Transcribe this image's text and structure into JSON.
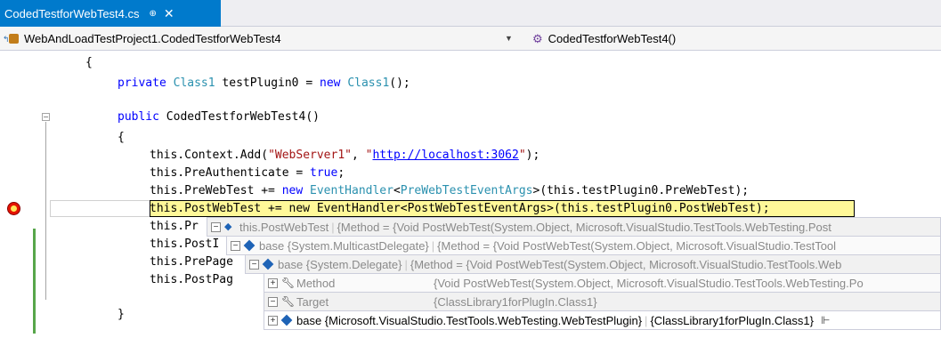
{
  "tab": {
    "title": "CodedTestforWebTest4.cs",
    "pin": "⊕",
    "close": "✕"
  },
  "navbar": {
    "class_combo": "WebAndLoadTestProject1.CodedTestforWebTest4",
    "member_combo": "CodedTestforWebTest4()"
  },
  "code": {
    "l0": "{",
    "l1_kw": "private",
    "l1_ty": "Class1",
    "l1_mid": " testPlugin0 = ",
    "l1_kw2": "new",
    "l1_ty2": "Class1",
    "l1_end": "();",
    "l2_kw": "public",
    "l2_rest": " CodedTestforWebTest4()",
    "l3": "{",
    "l4_pre": "this.Context.Add(",
    "l4_str": "\"WebServer1\"",
    "l4_mid": ", ",
    "l4_q1": "\"",
    "l4_url": "http://localhost:3062",
    "l4_q2": "\"",
    "l4_end": ");",
    "l5_pre": "this.PreAuthenticate = ",
    "l5_kw": "true",
    "l5_end": ";",
    "l6_pre": "this.PreWebTest += ",
    "l6_kw": "new",
    "l6_ty": "EventHandler",
    "l6_lt": "<",
    "l6_ty2": "PreWebTestEventArgs",
    "l6_end": ">(this.testPlugin0.PreWebTest);",
    "l7": "this.PostWebTest += new EventHandler<PostWebTestEventArgs>(this.testPlugin0.PostWebTest);",
    "l8": "this.Pr",
    "l9": "this.PostI",
    "l10": "this.PrePage",
    "l11": "this.PostPag",
    "l12": "}"
  },
  "datatips": [
    {
      "expander": "⊟",
      "name": "this.PostWebTest",
      "value": "{Method = {Void PostWebTest(System.Object, Microsoft.VisualStudio.TestTools.WebTesting.Post"
    },
    {
      "expander": "⊟",
      "name": "base {System.MulticastDelegate}",
      "value": "{Method = {Void PostWebTest(System.Object, Microsoft.VisualStudio.TestTool"
    },
    {
      "expander": "⊟",
      "name": "base {System.Delegate}",
      "value": "{Method = {Void PostWebTest(System.Object, Microsoft.VisualStudio.TestTools.Web"
    },
    {
      "expander": "⊞",
      "name": "Method",
      "value": "{Void PostWebTest(System.Object, Microsoft.VisualStudio.TestTools.WebTesting.Po"
    },
    {
      "expander": "⊟",
      "name": "Target",
      "value": "{ClassLibrary1forPlugIn.Class1}"
    },
    {
      "expander": "⊞",
      "name": "base {Microsoft.VisualStudio.TestTools.WebTesting.WebTestPlugin}",
      "value": "{ClassLibrary1forPlugIn.Class1}",
      "pin": "⊩"
    }
  ]
}
